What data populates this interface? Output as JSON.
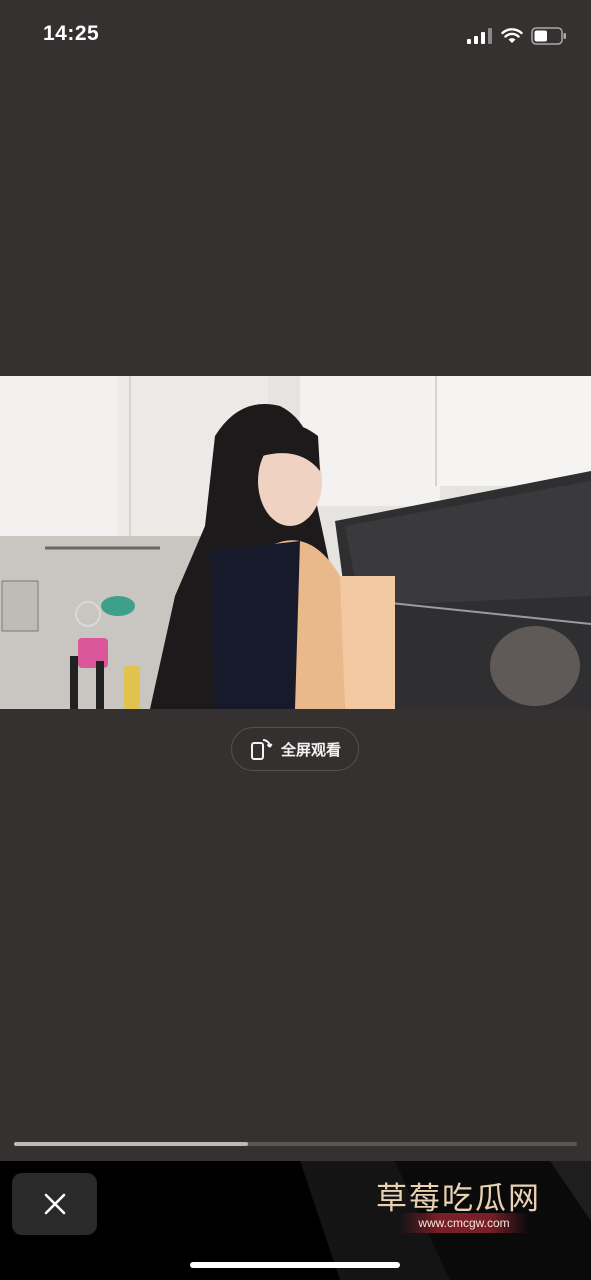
{
  "status_bar": {
    "time": "14:25",
    "icons": [
      "signal-icon",
      "wifi-icon",
      "battery-icon"
    ],
    "battery_level": 0.5
  },
  "player": {
    "fullscreen_label": "全屏观看",
    "progress": 0.415
  },
  "bottom": {
    "close_icon": "close-icon"
  },
  "watermark": {
    "title": "草莓吃瓜网",
    "url": "www.cmcgw.com"
  },
  "colors": {
    "background": "#343130",
    "bottom_bar": "#000000",
    "watermark_text": "#e9d2b3",
    "watermark_band": "#7a1f2a"
  }
}
